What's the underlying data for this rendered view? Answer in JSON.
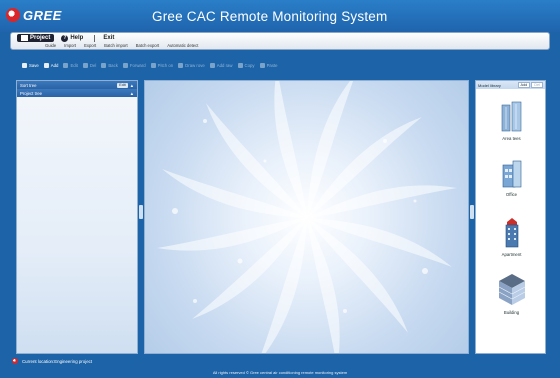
{
  "app": {
    "logo_text": "GREE",
    "title": "Gree CAC Remote Monitoring System"
  },
  "menu": {
    "tabs": [
      {
        "label": "Project",
        "icon": "project-icon",
        "active": true
      },
      {
        "label": "Help",
        "icon": "help-icon",
        "active": false
      },
      {
        "label": "Exit",
        "icon": "exit-icon",
        "active": false
      }
    ],
    "sub_items": [
      "Guide",
      "Import",
      "Export",
      "Batch import",
      "Batch export",
      "Automatic detect"
    ]
  },
  "toolbar": {
    "items": [
      {
        "label": "Save",
        "enabled": true
      },
      {
        "label": "Add",
        "enabled": true
      },
      {
        "label": "Edit",
        "enabled": false
      },
      {
        "label": "Del",
        "enabled": false
      },
      {
        "label": "Back",
        "enabled": false
      },
      {
        "label": "Forward",
        "enabled": false
      },
      {
        "label": "Pitch on",
        "enabled": false
      },
      {
        "label": "Draw rove",
        "enabled": false
      },
      {
        "label": "Add raw",
        "enabled": false
      },
      {
        "label": "Copy",
        "enabled": false
      },
      {
        "label": "Paste",
        "enabled": false
      }
    ]
  },
  "left_panel": {
    "sort_tree_label": "Sort tree",
    "edit_label": "Edit",
    "project_tree_label": "Project tree"
  },
  "right_panel": {
    "title": "Model library",
    "tabs": [
      "Add",
      "Del"
    ],
    "items": [
      {
        "label": "Area tees",
        "icon": "tower-icon"
      },
      {
        "label": "Office",
        "icon": "office-icon"
      },
      {
        "label": "Apartment",
        "icon": "apartment-icon"
      },
      {
        "label": "Building",
        "icon": "building-icon"
      }
    ]
  },
  "status": {
    "text": "Current location:Engineering project"
  },
  "footer": {
    "text": "All rights reserved © Gree central air conditioning remote monitoring system"
  },
  "colors": {
    "background": "#1c63a8",
    "accent_red": "#d9262a"
  }
}
